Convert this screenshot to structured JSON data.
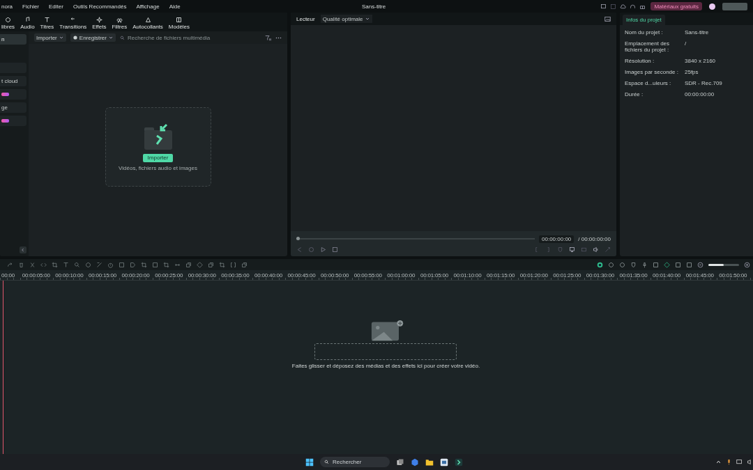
{
  "menu": {
    "app_name": "nora",
    "items": [
      "Fichier",
      "Editer",
      "Outils Recommandés",
      "Affichage",
      "Aide"
    ],
    "title": "Sans-titre",
    "promo": "Matériaux gratuits"
  },
  "media_tabs": [
    {
      "label": "libres"
    },
    {
      "label": "Audio"
    },
    {
      "label": "Titres"
    },
    {
      "label": "Transitions"
    },
    {
      "label": "Effets"
    },
    {
      "label": "Filtres"
    },
    {
      "label": "Autocollants"
    },
    {
      "label": "Modèles"
    }
  ],
  "sidebar": [
    {
      "kind": "text",
      "label": "n",
      "selected": true
    },
    {
      "kind": "blank",
      "selected": false
    },
    {
      "kind": "text",
      "label": "t cloud",
      "selected": false
    },
    {
      "kind": "badge",
      "selected": false
    },
    {
      "kind": "text",
      "label": "ge",
      "selected": false
    },
    {
      "kind": "badge",
      "selected": false
    }
  ],
  "media_toolbar": {
    "import": "Importer",
    "record": "Enregistrer",
    "search_placeholder": "Recherche de fichiers multimédia"
  },
  "drop_zone": {
    "button": "Importer",
    "hint": "Vidéos, fichiers audio et images"
  },
  "player": {
    "tab": "Lecteur",
    "quality": "Qualité optimale",
    "level": 0,
    "current_time": "00:00:00:00",
    "total_time": "/ 00:00:00:00"
  },
  "project_info": {
    "tab": "Infos du projet",
    "rows": [
      {
        "label": "Nom du projet :",
        "value": "Sans-titre"
      },
      {
        "label": "Emplacement des fichiers du projet :",
        "value": "/"
      },
      {
        "label": "Résolution :",
        "value": "3840 x 2160"
      },
      {
        "label": "Images par seconde :",
        "value": "25fps"
      },
      {
        "label": "Espace d...uleurs :",
        "value": "SDR - Rec.709"
      },
      {
        "label": "Durée :",
        "value": "00:00:00:00"
      }
    ]
  },
  "timeline": {
    "zoom": {
      "level": 0.5
    },
    "ruler": [
      "00:00",
      "00:00:05:00",
      "00:00:10:00",
      "00:00:15:00",
      "00:00:20:00",
      "00:00:25:00",
      "00:00:30:00",
      "00:00:35:00",
      "00:00:40:00",
      "00:00:45:00",
      "00:00:50:00",
      "00:00:55:00",
      "00:01:00:00",
      "00:01:05:00",
      "00:01:10:00",
      "00:01:15:00",
      "00:01:20:00",
      "00:01:25:00",
      "00:01:30:00",
      "00:01:35:00",
      "00:01:40:00",
      "00:01:45:00",
      "00:01:50:00"
    ],
    "drop_hint": "Faites glisser et déposez des médias et des effets ici pour créer votre vidéo."
  },
  "taskbar": {
    "search_placeholder": "Rechercher"
  }
}
